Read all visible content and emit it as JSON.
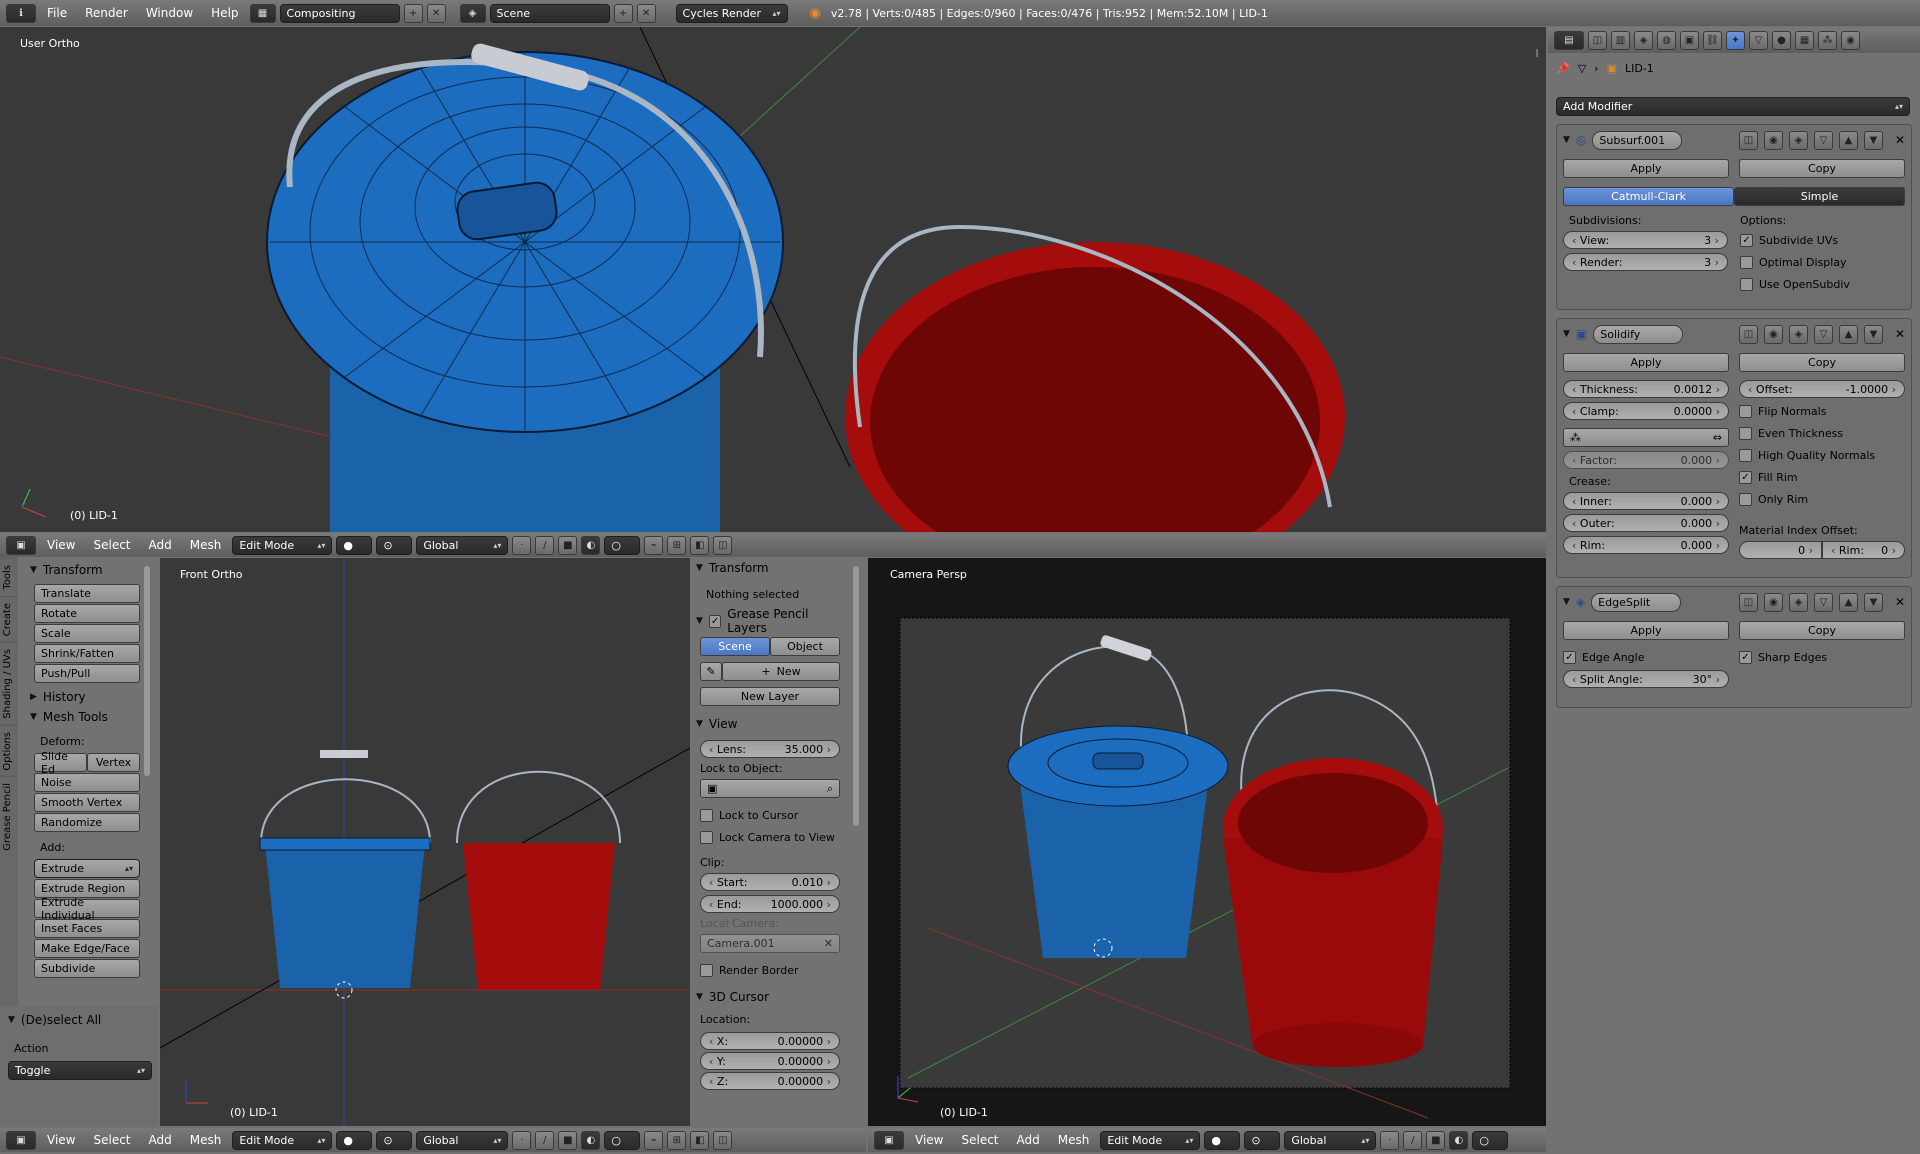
{
  "topbar": {
    "menus": [
      "File",
      "Render",
      "Window",
      "Help"
    ],
    "screen_layout": "Compositing",
    "scene": "Scene",
    "render_engine": "Cycles Render",
    "stats": "v2.78 | Verts:0/485 | Edges:0/960 | Faces:0/476 | Tris:952 | Mem:52.10M | LID-1"
  },
  "viewport_top": {
    "label": "User Ortho",
    "object": "(0) LID-1"
  },
  "viewport_front": {
    "label": "Front Ortho",
    "object": "(0) LID-1"
  },
  "viewport_camera": {
    "label": "Camera Persp",
    "object": "(0) LID-1"
  },
  "header3d": {
    "menus": [
      "View",
      "Select",
      "Add",
      "Mesh"
    ],
    "mode": "Edit Mode",
    "orientation": "Global"
  },
  "tool_tabs": [
    "Tools",
    "Create",
    "Shading / UVs",
    "Options",
    "Grease Pencil"
  ],
  "tool_shelf": {
    "transform_title": "Transform",
    "transform_buttons": [
      "Translate",
      "Rotate",
      "Scale",
      "Shrink/Fatten",
      "Push/Pull"
    ],
    "history_title": "History",
    "mesh_tools_title": "Mesh Tools",
    "deform_label": "Deform:",
    "deform_pair": [
      "Slide Ed",
      "Vertex"
    ],
    "deform_buttons": [
      "Noise",
      "Smooth Vertex",
      "Randomize"
    ],
    "add_label": "Add:",
    "extrude": "Extrude",
    "add_buttons": [
      "Extrude Region",
      "Extrude Individual",
      "Inset Faces",
      "Make Edge/Face",
      "Subdivide"
    ],
    "operator_title": "(De)select All",
    "action_label": "Action",
    "action_value": "Toggle"
  },
  "n_panel": {
    "transform_title": "Transform",
    "nothing_selected": "Nothing selected",
    "grease_title": "Grease Pencil Layers",
    "scene_tab": "Scene",
    "object_tab": "Object",
    "new": "New",
    "new_layer": "New Layer",
    "view_title": "View",
    "lens_label": "Lens:",
    "lens_value": "35.000",
    "lock_object_label": "Lock to Object:",
    "lock_cursor": "Lock to Cursor",
    "lock_camera": "Lock Camera to View",
    "clip_label": "Clip:",
    "start_label": "Start:",
    "start_value": "0.010",
    "end_label": "End:",
    "end_value": "1000.000",
    "local_camera_label": "Local Camera:",
    "local_camera_value": "Camera.001",
    "render_border": "Render Border",
    "cursor_title": "3D Cursor",
    "location_label": "Location:",
    "x_label": "X:",
    "x_value": "0.00000",
    "y_label": "Y:",
    "y_value": "0.00000",
    "z_label": "Z:",
    "z_value": "0.00000"
  },
  "properties": {
    "object_name": "LID-1",
    "add_modifier": "Add Modifier",
    "apply": "Apply",
    "copy": "Copy",
    "subsurf": {
      "name": "Subsurf.001",
      "catmull": "Catmull-Clark",
      "simple": "Simple",
      "subdivisions_label": "Subdivisions:",
      "view_label": "View:",
      "view_value": "3",
      "render_label": "Render:",
      "render_value": "3",
      "options_label": "Options:",
      "subdivide_uvs": "Subdivide UVs",
      "optimal_display": "Optimal Display",
      "use_opensubdiv": "Use OpenSubdiv"
    },
    "solidify": {
      "name": "Solidify",
      "thickness_label": "Thickness:",
      "thickness_value": "0.0012",
      "offset_label": "Offset:",
      "offset_value": "-1.0000",
      "clamp_label": "Clamp:",
      "clamp_value": "0.0000",
      "factor_label": "Factor:",
      "factor_value": "0.000",
      "crease_label": "Crease:",
      "inner_label": "Inner:",
      "inner_value": "0.000",
      "outer_label": "Outer:",
      "outer_value": "0.000",
      "rim_label": "Rim:",
      "rim_value": "0.000",
      "flip_normals": "Flip Normals",
      "even_thickness": "Even Thickness",
      "high_quality_normals": "High Quality Normals",
      "fill_rim": "Fill Rim",
      "only_rim": "Only Rim",
      "mat_index_label": "Material Index Offset:",
      "mat_index_value": "0",
      "mat_rim_label": "Rim:",
      "mat_rim_value": "0"
    },
    "edgesplit": {
      "name": "EdgeSplit",
      "edge_angle": "Edge Angle",
      "sharp_edges": "Sharp Edges",
      "split_angle_label": "Split Angle:",
      "split_angle_value": "30°"
    }
  },
  "colors": {
    "accent": "#5680c2",
    "bucket_blue": "#1a6ab8",
    "bucket_red": "#b01010",
    "viewport": "#393939"
  }
}
